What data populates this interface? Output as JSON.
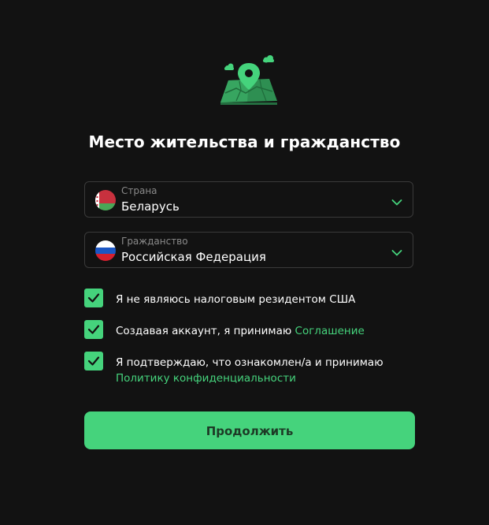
{
  "page": {
    "title": "Место жительства и гражданство"
  },
  "country_select": {
    "label": "Страна",
    "value": "Беларусь",
    "flag_icon": "belarus-flag-icon"
  },
  "citizenship_select": {
    "label": "Гражданство",
    "value": "Российская Федерация",
    "flag_icon": "russia-flag-icon"
  },
  "checks": {
    "tax_resident": {
      "checked": true,
      "text": "Я не являюсь налоговым резидентом США"
    },
    "agreement": {
      "checked": true,
      "text": "Создавая аккаунт, я принимаю",
      "link": "Соглашение"
    },
    "privacy": {
      "checked": true,
      "text": "Я подтверждаю, что ознакомлен/а и принимаю",
      "link": "Политику конфиденциальности"
    }
  },
  "continue_button": {
    "label": "Продолжить"
  },
  "colors": {
    "accent": "#45d37c",
    "background": "#121212",
    "border": "#3a3a3a",
    "muted_text": "#8a8a8a",
    "button_text": "#1d3a26"
  }
}
